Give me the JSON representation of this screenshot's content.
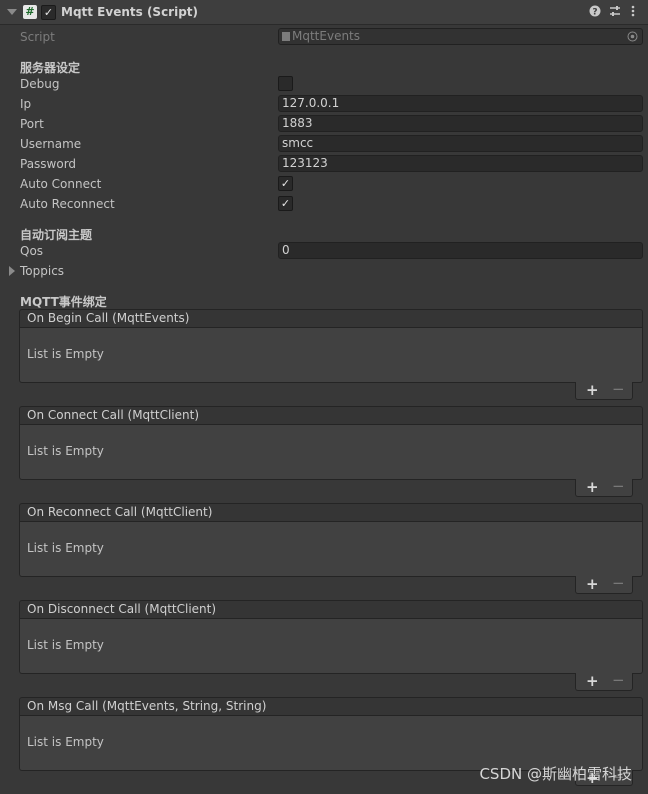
{
  "header": {
    "title": "Mqtt Events (Script)",
    "script_icon_glyph": "#",
    "enabled_check": "✓",
    "help_icon": "help-icon",
    "settings_icon": "sliders-icon",
    "menu_icon": "kebab-menu-icon"
  },
  "script_field": {
    "label": "Script",
    "value": "MqttEvents"
  },
  "server_section": {
    "title": "服务器设定"
  },
  "fields": {
    "debug": {
      "label": "Debug",
      "checked": ""
    },
    "ip": {
      "label": "Ip",
      "value": "127.0.0.1"
    },
    "port": {
      "label": "Port",
      "value": "1883"
    },
    "username": {
      "label": "Username",
      "value": "smcc"
    },
    "password": {
      "label": "Password",
      "value": "123123"
    },
    "auto_connect": {
      "label": "Auto Connect",
      "checked": "✓"
    },
    "auto_reconnect": {
      "label": "Auto Reconnect",
      "checked": "✓"
    }
  },
  "subscribe_section": {
    "title": "自动订阅主题"
  },
  "qos": {
    "label": "Qos",
    "value": "0"
  },
  "toppics": {
    "label": "Toppics"
  },
  "events_section": {
    "title": "MQTT事件绑定"
  },
  "events": [
    {
      "title": "On Begin Call (MqttEvents)",
      "empty_text": "List is Empty"
    },
    {
      "title": "On Connect Call (MqttClient)",
      "empty_text": "List is Empty"
    },
    {
      "title": "On Reconnect Call (MqttClient)",
      "empty_text": "List is Empty"
    },
    {
      "title": "On Disconnect Call (MqttClient)",
      "empty_text": "List is Empty"
    },
    {
      "title": "On Msg Call (MqttEvents, String, String)",
      "empty_text": "List is Empty"
    }
  ],
  "list_buttons": {
    "add": "+",
    "remove": "−"
  },
  "watermark": "CSDN @斯幽柏雷科技"
}
